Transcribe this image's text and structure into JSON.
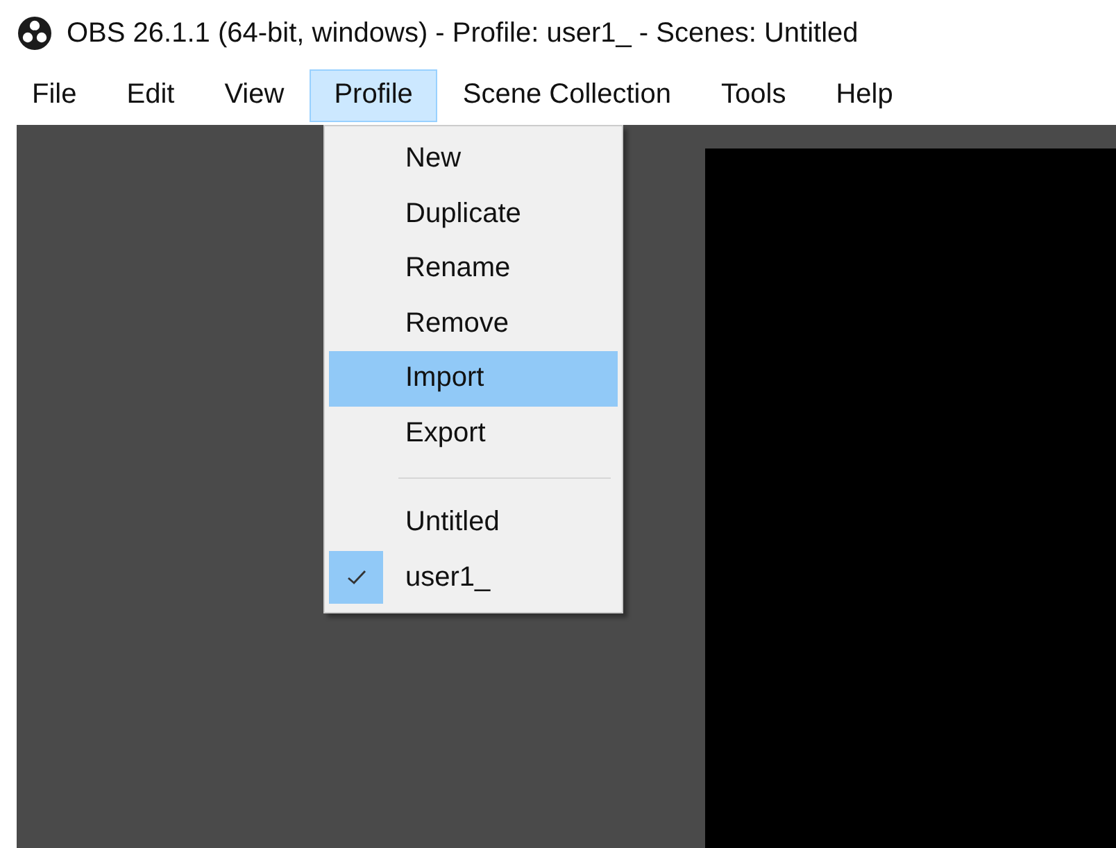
{
  "window": {
    "title": "OBS 26.1.1 (64-bit, windows) - Profile: user1_ - Scenes: Untitled"
  },
  "menu_bar": [
    {
      "label": "File",
      "selected": false
    },
    {
      "label": "Edit",
      "selected": false
    },
    {
      "label": "View",
      "selected": false
    },
    {
      "label": "Profile",
      "selected": true
    },
    {
      "label": "Scene Collection",
      "selected": false
    },
    {
      "label": "Tools",
      "selected": false
    },
    {
      "label": "Help",
      "selected": false
    }
  ],
  "profile_menu": [
    {
      "kind": "action",
      "label": "New",
      "selected": false
    },
    {
      "kind": "action",
      "label": "Duplicate",
      "selected": false
    },
    {
      "kind": "action",
      "label": "Rename",
      "selected": false
    },
    {
      "kind": "action",
      "label": "Remove",
      "selected": false
    },
    {
      "kind": "action",
      "label": "Import",
      "selected": true
    },
    {
      "kind": "action",
      "label": "Export",
      "selected": false
    },
    {
      "kind": "separator"
    },
    {
      "kind": "profile",
      "label": "Untitled",
      "selected": false,
      "checked": false
    },
    {
      "kind": "profile",
      "label": "user1_",
      "selected": false,
      "checked": true
    }
  ]
}
